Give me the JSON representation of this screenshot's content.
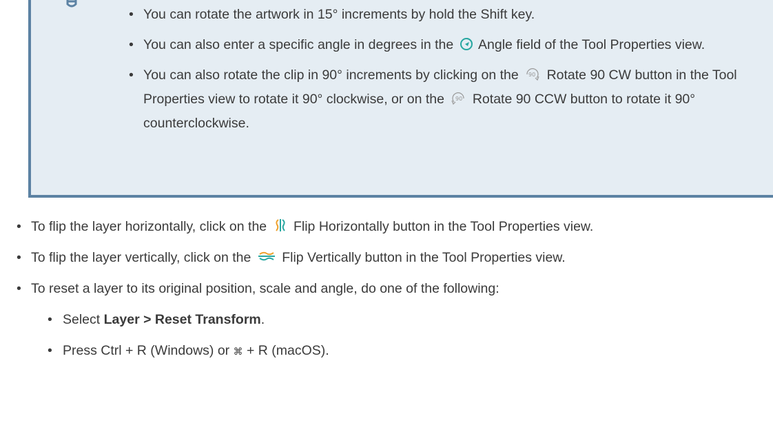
{
  "tip": {
    "items": [
      {
        "text": "You can rotate the artwork in 15° increments by hold the Shift key."
      },
      {
        "pre": "You can also enter a specific angle in degrees in the",
        "icon": "angle-icon",
        "post": "Angle field of the Tool Properties view."
      },
      {
        "pre": "You can also rotate the clip in 90° increments by clicking on the",
        "icon1": "rotate-90-cw-icon",
        "mid": "Rotate 90 CW button in the Tool Properties view to rotate it 90° clockwise, or on the",
        "icon2": "rotate-90-ccw-icon",
        "post": "Rotate 90 CCW button to rotate it 90° counterclockwise."
      }
    ]
  },
  "main": {
    "items": [
      {
        "pre": "To flip the layer horizontally, click on the",
        "icon": "flip-horizontal-icon",
        "post": "Flip Horizontally button in the Tool Properties view."
      },
      {
        "pre": "To flip the layer vertically, click on the",
        "icon": "flip-vertical-icon",
        "post": "Flip Vertically button in the Tool Properties view."
      },
      {
        "text": "To reset a layer to its original position, scale and angle, do one of the following:"
      }
    ],
    "subitems": [
      {
        "pre": "Select ",
        "bold": "Layer > Reset Transform",
        "post": "."
      },
      {
        "pre": "Press Ctrl + R (Windows) or ",
        "key": "⌘",
        "post": " + R (macOS)."
      }
    ]
  },
  "colors": {
    "tip_bg": "#e5edf3",
    "tip_border": "#5c82a3",
    "icon_teal": "#28a7a1",
    "text": "#3b3b3b"
  }
}
